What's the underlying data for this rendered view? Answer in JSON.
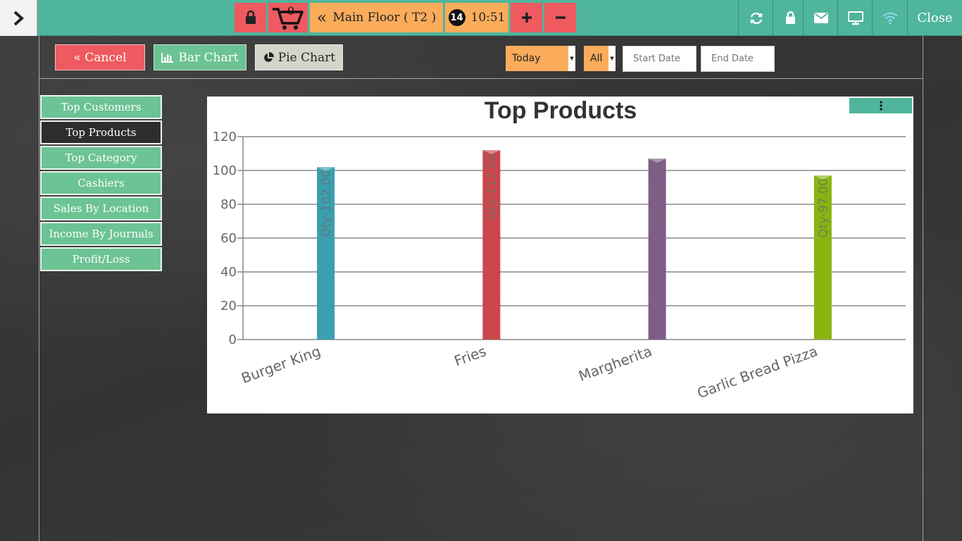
{
  "topbar": {
    "cart_count": "0",
    "floor_label": "Main Floor ( T2 )",
    "table_badge": "14",
    "time": "10:51",
    "close_label": "Close"
  },
  "toolbar": {
    "cancel_label": "« Cancel",
    "bar_chart_label": "Bar Chart",
    "pie_chart_label": "Pie Chart",
    "period_select": "Today",
    "filter_select": "All",
    "start_date_placeholder": "Start Date",
    "end_date_placeholder": "End Date"
  },
  "sidebar": {
    "items": [
      {
        "label": "Top Customers"
      },
      {
        "label": "Top Products"
      },
      {
        "label": "Top Category"
      },
      {
        "label": "Cashiers"
      },
      {
        "label": "Sales By Location"
      },
      {
        "label": "Income By Journals"
      },
      {
        "label": "Profit/Loss"
      }
    ]
  },
  "colors": {
    "topbar": "#4fb59d",
    "red_button": "#ee5a5f",
    "orange_button": "#fbac5b",
    "sidebar_item": "#6cc394",
    "sidebar_active": "#2d2d2d"
  },
  "chart_data": {
    "type": "bar",
    "title": "Top Products",
    "categories": [
      "Burger King",
      "Fries",
      "Margherita",
      "Garlic Bread Pizza"
    ],
    "values": [
      102,
      112,
      107,
      97
    ],
    "data_labels": [
      "Qty-102.00",
      "Qty-112.00",
      "Qty-107.00",
      "Qty-97.00"
    ],
    "colors": [
      "#3a9fb0",
      "#c9474a",
      "#805c88",
      "#88b510"
    ],
    "ylim": [
      0,
      120
    ],
    "yticks": [
      "0",
      "20",
      "40",
      "60",
      "80",
      "100",
      "120"
    ],
    "grid": true
  }
}
